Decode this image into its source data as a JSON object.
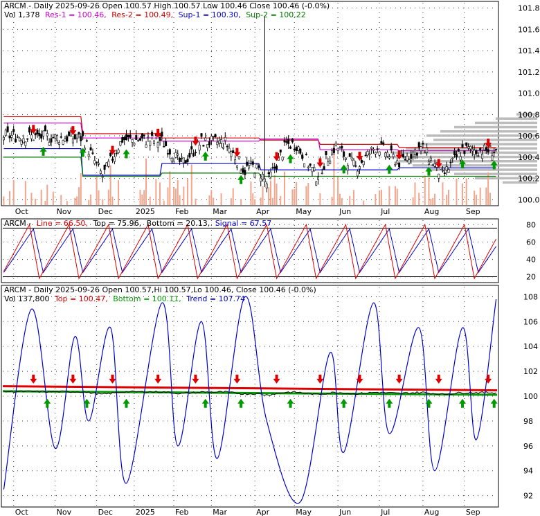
{
  "colors": {
    "background": "#ffffff",
    "border": "#000000",
    "grid": "#333333",
    "volume": "#f4a58c",
    "res1": "#cc00cc",
    "res2": "#cc0000",
    "sup1": "#0000cc",
    "sup2": "#007700",
    "profile": "#b0b0b0",
    "arrow_up": "#009900",
    "arrow_down": "#dd0000",
    "line": "#dd0000",
    "signal": "#0000cc",
    "trend": "#0000cc",
    "top": "#dd0000",
    "bottom": "#009900",
    "price_line": "#000000"
  },
  "chart_data": [
    {
      "type": "candlestick",
      "panel": "price",
      "title_line1": "ARCM - Daily 2025-09-26 Open 100.57  High 100.57  Low 100.46  Close 100.46 (-0.0%)",
      "legend": [
        {
          "text": "Vol 1,378",
          "color": "#000000"
        },
        {
          "text": "Res-1 = 100.46,",
          "color": "#cc00cc"
        },
        {
          "text": "Res-2 = 100.49,",
          "color": "#cc0000"
        },
        {
          "text": "Sup-1 = 100.30,",
          "color": "#0000cc"
        },
        {
          "text": "Sup-2 = 100.22",
          "color": "#007700"
        }
      ],
      "ylim": [
        99.95,
        101.85
      ],
      "yticks": [
        "101.8",
        "101.6",
        "101.4",
        "101.2",
        "101.0",
        "100.8",
        "100.6",
        "100.4",
        "100.2",
        "100.0"
      ],
      "xticks": [
        "Oct",
        "Nov",
        "Dec",
        "2025",
        "Feb",
        "Mar",
        "Apr",
        "May",
        "Jun",
        "Jul",
        "Aug",
        "Sep"
      ],
      "grid": true,
      "n_bars": 250,
      "candles": {
        "start": 100.6,
        "end": 100.46,
        "dips": [
          {
            "bar": 50,
            "value": 100.22
          },
          {
            "bar": 90,
            "value": 100.33
          },
          {
            "bar": 122,
            "value": 100.27
          },
          {
            "bar": 133,
            "value": 100.15
          },
          {
            "bar": 158,
            "value": 100.22
          },
          {
            "bar": 178,
            "value": 100.3
          },
          {
            "bar": 200,
            "value": 100.35
          },
          {
            "bar": 222,
            "value": 100.22
          }
        ],
        "spike": {
          "bar": 132,
          "high": 101.72
        }
      },
      "resistance_steps": [
        {
          "res2": 100.78,
          "res1": 100.72,
          "sup1": 100.48,
          "sup2": 100.4,
          "from": 0,
          "to": 40
        },
        {
          "res2": 100.62,
          "res1": 100.58,
          "sup1": 100.23,
          "sup2": 100.22,
          "from": 40,
          "to": 80
        },
        {
          "res2": 100.58,
          "res1": 100.55,
          "sup1": 100.34,
          "sup2": 100.25,
          "from": 80,
          "to": 130
        },
        {
          "res2": 100.56,
          "res1": 100.57,
          "sup1": 100.28,
          "sup2": 100.22,
          "from": 130,
          "to": 160
        },
        {
          "res2": 100.52,
          "res1": 100.47,
          "sup1": 100.28,
          "sup2": 100.22,
          "from": 160,
          "to": 200
        },
        {
          "res2": 100.49,
          "res1": 100.46,
          "sup1": 100.3,
          "sup2": 100.22,
          "from": 200,
          "to": 250
        }
      ],
      "volume_relative": [
        0.2,
        0.3,
        0.1,
        0.5,
        0.4,
        0.7,
        0.2,
        0.15,
        0.3,
        0.6,
        0.25,
        0.4,
        0.9,
        0.1,
        0.3,
        0.45,
        0.2,
        1.0,
        0.35,
        0.5,
        0.2,
        0.15,
        0.6,
        0.3,
        0.8,
        0.25,
        0.4,
        0.3,
        0.55,
        0.2
      ],
      "arrows_up": [
        20,
        40,
        62,
        102,
        120,
        145,
        172,
        195,
        215,
        232,
        248
      ],
      "arrows_down": [
        15,
        35,
        55,
        78,
        97,
        118,
        138,
        160,
        180,
        200,
        220,
        245
      ]
    },
    {
      "type": "line",
      "panel": "oscillator",
      "title": "ARCM - Line = 66.50, Top = 75.96, Bottom = 20.13, Signal = 67.57",
      "legend": [
        {
          "text": "ARCM -",
          "color": "#000000"
        },
        {
          "text": "Line = 66.50,",
          "color": "#dd0000"
        },
        {
          "text": "Top = 75.96,",
          "color": "#000000"
        },
        {
          "text": "Bottom = 20.13,",
          "color": "#000000"
        },
        {
          "text": "Signal = 67.57",
          "color": "#0000cc"
        }
      ],
      "ylim": [
        15,
        85
      ],
      "yticks": [
        "80",
        "60",
        "40",
        "20"
      ],
      "top": 75.96,
      "bottom": 20.13,
      "series": [
        {
          "name": "Line",
          "cycle_bars": 20,
          "high": 80,
          "low": 18
        },
        {
          "name": "Signal",
          "cycle_bars": 20,
          "high": 75,
          "low": 25
        }
      ]
    },
    {
      "type": "line",
      "panel": "trend",
      "title_line1": "ARCM - Daily 2025-09-26 Open 100.57,Hi 100.57,Lo 100.46, Close 100.46 (-0.0%)",
      "legend": [
        {
          "text": "Vol 137,800",
          "color": "#000000"
        },
        {
          "text": "Top = 100.47,",
          "color": "#dd0000"
        },
        {
          "text": "Bottom = 100.11,",
          "color": "#009900"
        },
        {
          "text": "Trend = 107.74",
          "color": "#0000cc"
        }
      ],
      "ylim": [
        91.2,
        108.8
      ],
      "yticks": [
        "108",
        "106",
        "104",
        "102",
        "100",
        "98",
        "96",
        "94",
        "92"
      ],
      "xticks": [
        "Oct",
        "Nov",
        "Dec",
        "2025",
        "Feb",
        "Mar",
        "Apr",
        "May",
        "Jun",
        "Jul",
        "Aug",
        "Sep"
      ],
      "trend_points": [
        {
          "bar": 0,
          "value": 92.5
        },
        {
          "bar": 14,
          "value": 107.0
        },
        {
          "bar": 26,
          "value": 95.8
        },
        {
          "bar": 36,
          "value": 104.8
        },
        {
          "bar": 43,
          "value": 98.0
        },
        {
          "bar": 54,
          "value": 105.5
        },
        {
          "bar": 62,
          "value": 93.0
        },
        {
          "bar": 80,
          "value": 107.5
        },
        {
          "bar": 88,
          "value": 96.0
        },
        {
          "bar": 100,
          "value": 106.0
        },
        {
          "bar": 108,
          "value": 95.0
        },
        {
          "bar": 122,
          "value": 108.0
        },
        {
          "bar": 133,
          "value": 98.0
        },
        {
          "bar": 150,
          "value": 91.5
        },
        {
          "bar": 165,
          "value": 103.5
        },
        {
          "bar": 172,
          "value": 95.5
        },
        {
          "bar": 187,
          "value": 107.5
        },
        {
          "bar": 195,
          "value": 97.0
        },
        {
          "bar": 210,
          "value": 105.5
        },
        {
          "bar": 218,
          "value": 94.0
        },
        {
          "bar": 232,
          "value": 105.5
        },
        {
          "bar": 239,
          "value": 96.5
        },
        {
          "bar": 249,
          "value": 107.8
        }
      ],
      "top_line": {
        "start": 100.8,
        "end": 100.47
      },
      "bottom_line": {
        "start": 100.4,
        "end": 100.11
      },
      "arrows_up": [
        22,
        42,
        62,
        102,
        120,
        145,
        172,
        195,
        215,
        232,
        248
      ],
      "arrows_down": [
        15,
        35,
        55,
        78,
        97,
        118,
        138,
        160,
        180,
        200,
        220,
        245
      ]
    }
  ]
}
